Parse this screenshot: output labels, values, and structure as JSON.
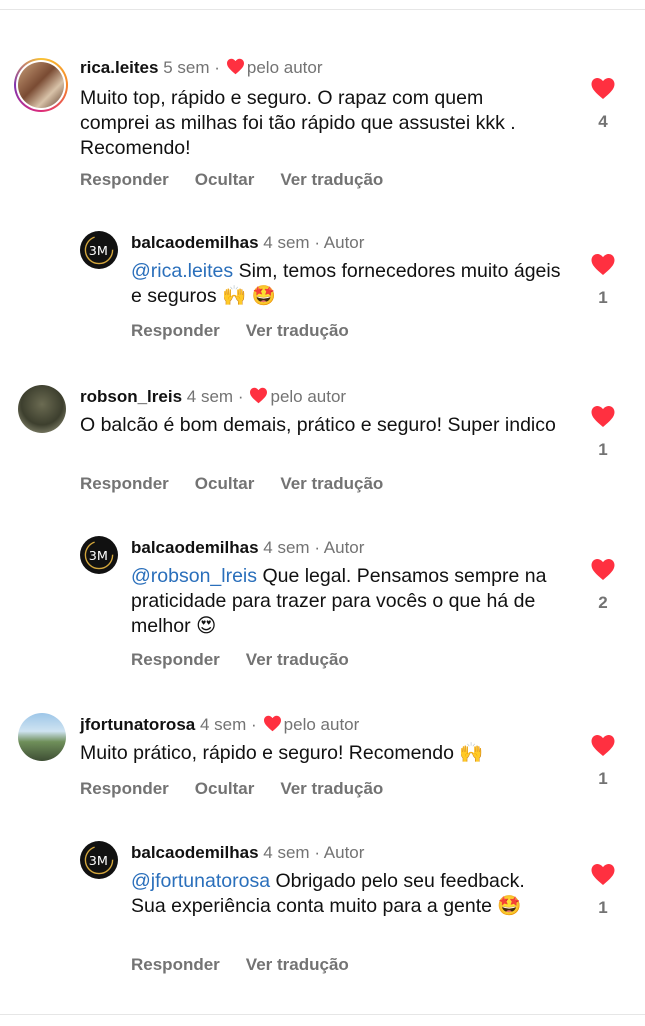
{
  "comments": [
    {
      "username": "rica.leites",
      "time": "5 sem",
      "liked_by": "pelo autor",
      "text": "Muito top, rápido e seguro. O rapaz com quem comprei as milhas foi tão rápido que assustei kkk . Recomendo!",
      "likes": "4",
      "actions": [
        "Responder",
        "Ocultar",
        "Ver tradução"
      ],
      "reply": {
        "username": "balcaodemilhas",
        "time": "4 sem",
        "role": "Autor",
        "mention": "@rica.leites",
        "text": " Sim, temos fornecedores muito ágeis e seguros 🙌 🤩",
        "likes": "1",
        "actions": [
          "Responder",
          "Ver tradução"
        ]
      }
    },
    {
      "username": "robson_lreis",
      "time": "4 sem",
      "liked_by": "pelo autor",
      "text": "O balcão é bom demais, prático e seguro! Super indico",
      "likes": "1",
      "actions": [
        "Responder",
        "Ocultar",
        "Ver tradução"
      ],
      "reply": {
        "username": "balcaodemilhas",
        "time": "4 sem",
        "role": "Autor",
        "mention": "@robson_lreis",
        "text": " Que legal. Pensamos sempre na praticidade para trazer para vocês o que há de melhor 😍",
        "likes": "2",
        "actions": [
          "Responder",
          "Ver tradução"
        ]
      }
    },
    {
      "username": "jfortunatorosa",
      "time": "4 sem",
      "liked_by": "pelo autor",
      "text": "Muito prático, rápido e seguro! Recomendo 🙌",
      "likes": "1",
      "actions": [
        "Responder",
        "Ocultar",
        "Ver tradução"
      ],
      "reply": {
        "username": "balcaodemilhas",
        "time": "4 sem",
        "role": "Autor",
        "mention": "@jfortunatorosa",
        "text": " Obrigado pelo seu feedback. Sua experiência conta muito para a gente 🤩",
        "likes": "1",
        "actions": [
          "Responder",
          "Ver tradução"
        ]
      }
    }
  ],
  "colors": {
    "heart": "#ff3040",
    "mention": "#2a6fbb",
    "meta": "#737373"
  },
  "icons": {
    "heart": "heart-icon",
    "logo": "bm-logo-icon"
  }
}
